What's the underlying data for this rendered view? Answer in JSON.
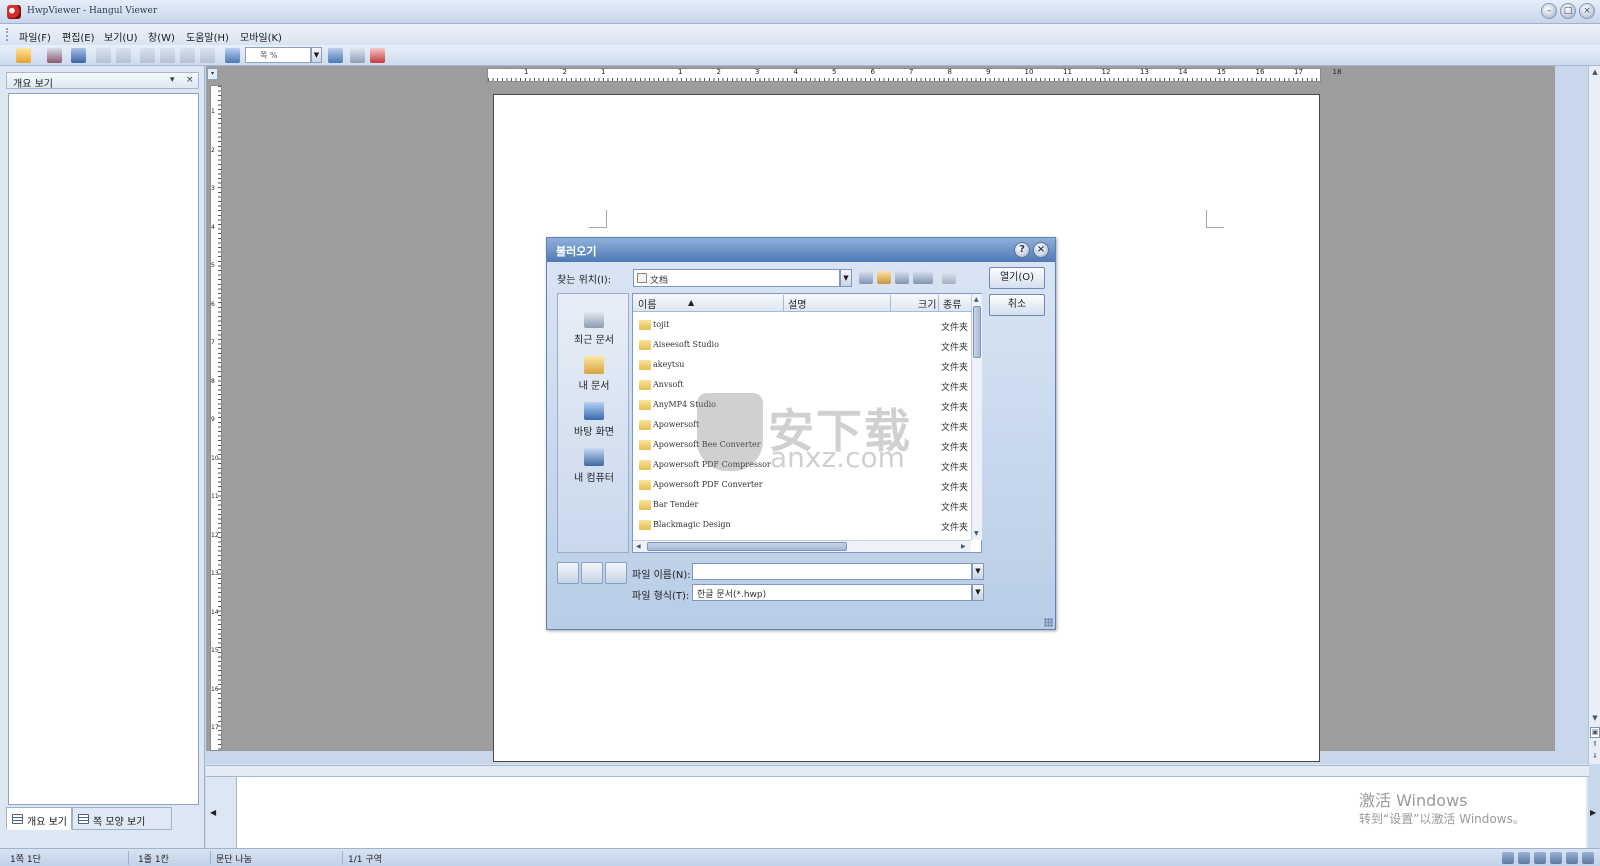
{
  "window": {
    "title": "HwpViewer - Hangul Viewer"
  },
  "menu": [
    "파일(F)",
    "편집(E)",
    "보기(U)",
    "창(W)",
    "도움말(H)",
    "모바일(K)"
  ],
  "toolbar": {
    "zoom_value": "쪽 %"
  },
  "left_panel": {
    "title": "개요 보기",
    "tabs": [
      "개요 보기",
      "쪽 모양 보기"
    ]
  },
  "ruler": {
    "h_numbers": [
      "1",
      "2",
      "1",
      "",
      "1",
      "2",
      "3",
      "4",
      "5",
      "6",
      "7",
      "8",
      "9",
      "10",
      "11",
      "12",
      "13",
      "14",
      "15",
      "16",
      "17",
      "18"
    ],
    "v_numbers": [
      "1",
      "2",
      "3",
      "4",
      "5",
      "6",
      "7",
      "8",
      "9",
      "10",
      "11",
      "12",
      "13",
      "14",
      "15",
      "16",
      "17"
    ]
  },
  "dialog": {
    "title": "불러오기",
    "help_label": "?",
    "close_label": "×",
    "look_in_label": "찾는 위치(I):",
    "look_in_value": "文档",
    "places": [
      "최근 문서",
      "내 문서",
      "바탕 화면",
      "내 컴퓨터"
    ],
    "columns": [
      "이름",
      "설명",
      "크기",
      "종류"
    ],
    "files": [
      {
        "name": "tojit",
        "type": "文件夹"
      },
      {
        "name": "Aiseesoft Studio",
        "type": "文件夹"
      },
      {
        "name": "akeytsu",
        "type": "文件夹"
      },
      {
        "name": "Anvsoft",
        "type": "文件夹"
      },
      {
        "name": "AnyMP4 Studio",
        "type": "文件夹"
      },
      {
        "name": "Apowersoft",
        "type": "文件夹"
      },
      {
        "name": "Apowersoft Bee Converter",
        "type": "文件夹"
      },
      {
        "name": "Apowersoft PDF Compressor",
        "type": "文件夹"
      },
      {
        "name": "Apowersoft PDF Converter",
        "type": "文件夹"
      },
      {
        "name": "Bar Tender",
        "type": "文件夹"
      },
      {
        "name": "Blackmagic Design",
        "type": "文件夹"
      }
    ],
    "open_button": "열기(O)",
    "cancel_button": "취소",
    "filename_label": "파일 이름(N):",
    "filename_value": "",
    "filetype_label": "파일 형식(T):",
    "filetype_value": "한글 문서(*.hwp)"
  },
  "watermark": {
    "activate_title": "激活 Windows",
    "activate_sub": "转到“设置”以激活 Windows。",
    "site_cn": "安下载",
    "site_en": "anxz.com"
  },
  "statusbar": [
    "1쪽 1단",
    "1줄 1칸",
    "문단 나눔",
    "1/1 구역"
  ]
}
